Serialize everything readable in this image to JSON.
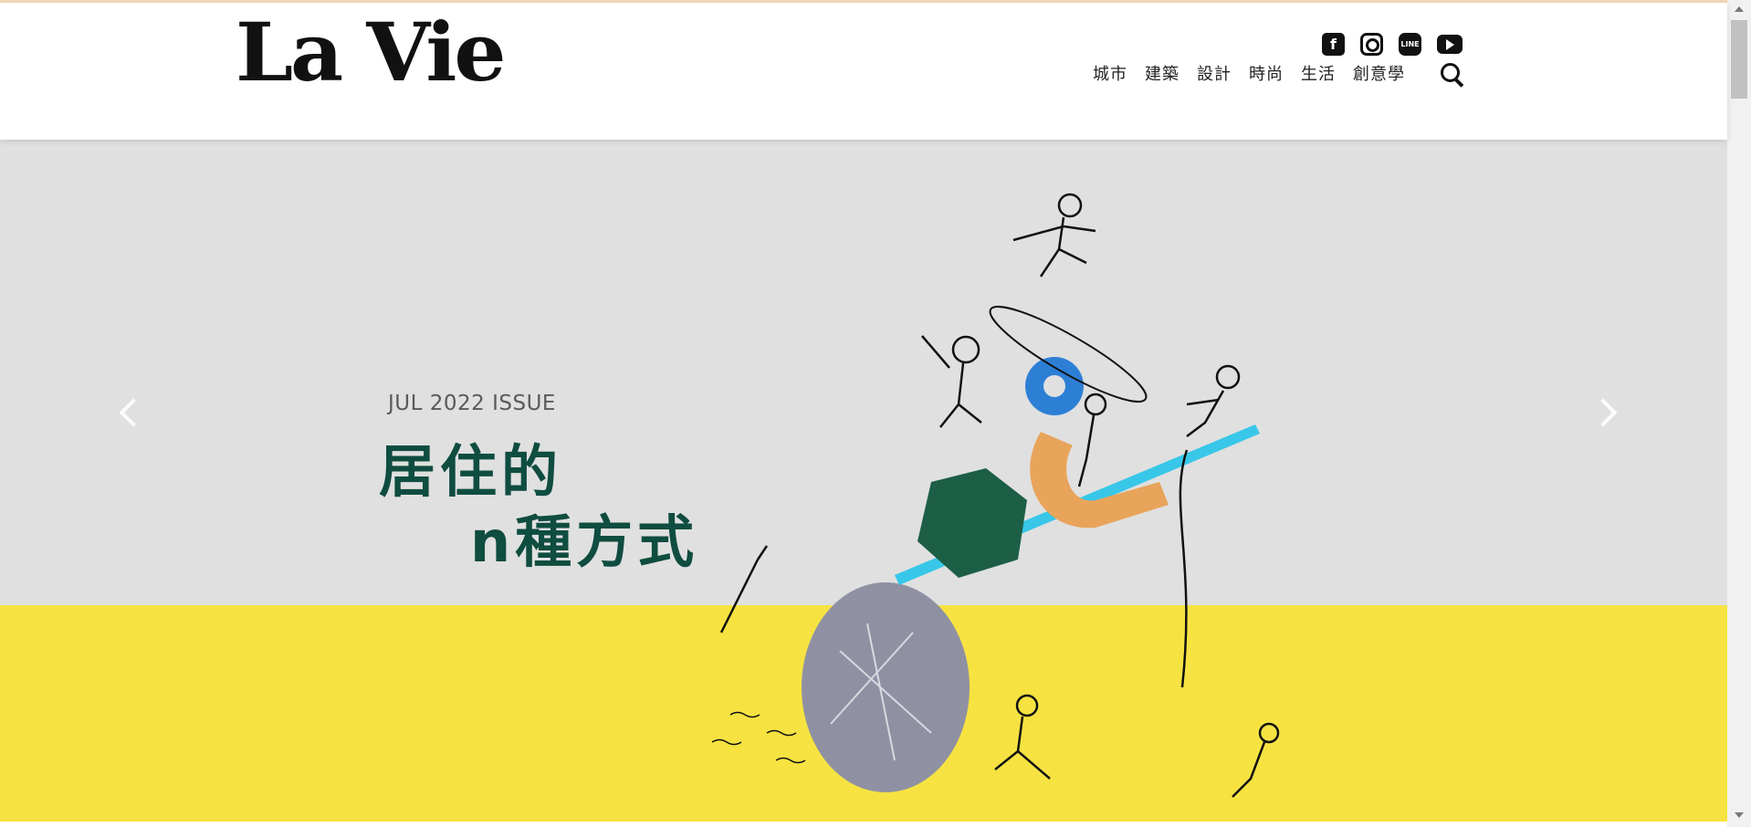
{
  "header": {
    "logo": "La Vie",
    "social": [
      {
        "name": "facebook-icon",
        "glyph": "f"
      },
      {
        "name": "instagram-icon",
        "glyph": ""
      },
      {
        "name": "line-icon",
        "glyph": "LINE"
      },
      {
        "name": "youtube-icon",
        "glyph": ""
      }
    ],
    "nav": [
      "城市",
      "建築",
      "設計",
      "時尚",
      "生活",
      "創意學"
    ]
  },
  "hero": {
    "issue": "JUL 2022 ISSUE",
    "headline_line1": "居住的",
    "headline_line2": "n種方式"
  },
  "colors": {
    "headline": "#0f4d40",
    "floor": "#f6e342",
    "backdrop": "#e0e0e0",
    "accent_blue": "#2d7fd6",
    "accent_orange": "#e8a45a",
    "accent_cyan": "#38c7e8"
  }
}
